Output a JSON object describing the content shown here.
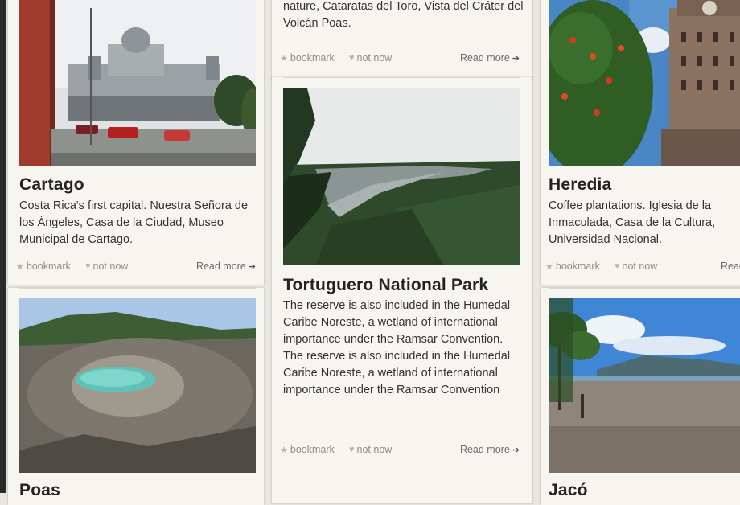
{
  "colors": {
    "background": "#e9e7e0",
    "card": "#f6f5f0",
    "muted_text": "#8d8d88"
  },
  "cards": {
    "cartago": {
      "title": "Cartago",
      "description": "Costa Rica's first capital. Nuestra Señora de los Ángeles, Casa de la Ciudad, Museo Municipal de Cartago.",
      "bookmark": "bookmark",
      "not_now": "not now",
      "read_more": "Read more"
    },
    "poas_top": {
      "description": "stratovolcano in central Costa Rica. Exploring nature, Cataratas del Toro, Vista del Cráter del Volcán Poas.",
      "bookmark": "bookmark",
      "not_now": "not now",
      "read_more": "Read more"
    },
    "tortuguero": {
      "title": "Tortuguero National Park",
      "description": "The reserve is also included in the Humedal Caribe Noreste, a wetland of international importance under the Ramsar Convention. The reserve is also included in the Humedal Caribe Noreste, a wetland of international importance under the Ramsar Convention",
      "bookmark": "bookmark",
      "not_now": "not now",
      "read_more": "Read more"
    },
    "heredia": {
      "title": "Heredia",
      "description": "Coffee plantations. Iglesia de la Inmaculada, Casa de la Cultura, Universidad Nacional.",
      "bookmark": "bookmark",
      "not_now": "not now",
      "read_more": "Read more"
    },
    "poas": {
      "title": "Poas"
    },
    "jaco": {
      "title": "Jacó"
    }
  },
  "icons": {
    "bookmark": "star-icon",
    "not_now": "thumbs-down-icon",
    "read_more": "arrow-right-icon"
  }
}
